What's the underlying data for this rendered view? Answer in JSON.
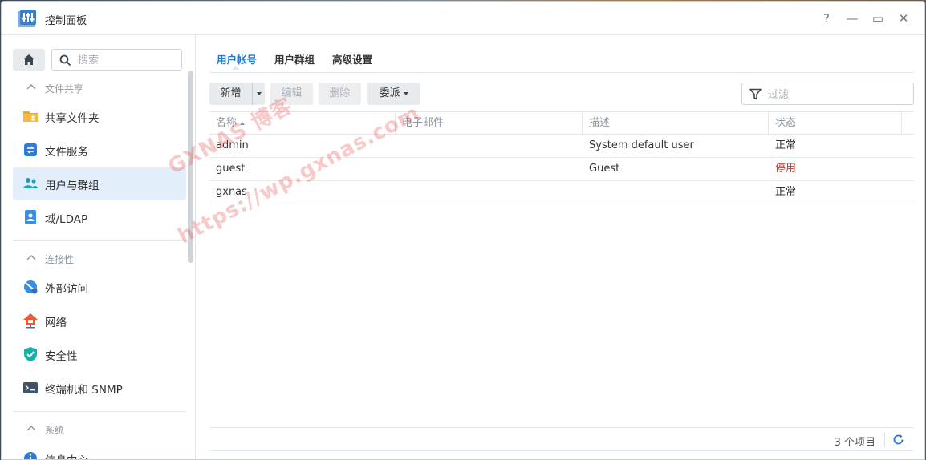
{
  "window": {
    "title": "控制面板"
  },
  "window_controls": {
    "help": "?",
    "minimize": "—",
    "maximize": "▭",
    "close": "✕"
  },
  "sidebar": {
    "search_placeholder": "搜索",
    "sections": [
      {
        "label": "文件共享",
        "items": [
          {
            "label": "共享文件夹",
            "icon": "shared-folder-icon"
          },
          {
            "label": "文件服务",
            "icon": "file-services-icon"
          },
          {
            "label": "用户与群组",
            "icon": "users-groups-icon",
            "active": true
          },
          {
            "label": "域/LDAP",
            "icon": "domain-ldap-icon"
          }
        ]
      },
      {
        "label": "连接性",
        "items": [
          {
            "label": "外部访问",
            "icon": "external-access-icon"
          },
          {
            "label": "网络",
            "icon": "network-icon"
          },
          {
            "label": "安全性",
            "icon": "security-shield-icon"
          },
          {
            "label": "终端机和 SNMP",
            "icon": "terminal-icon"
          }
        ]
      },
      {
        "label": "系统",
        "items": [
          {
            "label": "信息中心",
            "icon": "info-center-icon"
          }
        ]
      }
    ]
  },
  "tabs": [
    {
      "label": "用户帐号",
      "active": true
    },
    {
      "label": "用户群组"
    },
    {
      "label": "高级设置"
    }
  ],
  "toolbar": {
    "create": "新增",
    "edit": "编辑",
    "delete": "删除",
    "delegate": "委派",
    "filter_placeholder": "过滤"
  },
  "table": {
    "columns": [
      "名称",
      "电子邮件",
      "描述",
      "状态"
    ],
    "rows": [
      {
        "name": "admin",
        "email": "",
        "description": "System default user",
        "status": "正常"
      },
      {
        "name": "guest",
        "email": "",
        "description": "Guest",
        "status": "停用"
      },
      {
        "name": "gxnas",
        "email": "",
        "description": "",
        "status": "正常"
      }
    ]
  },
  "footer": {
    "count": "3 个项目"
  },
  "watermark": {
    "line1": "GXNAS 博客",
    "line2": "https://wp.gxnas.com"
  },
  "colors": {
    "accent": "#1d7ad0",
    "active_bg": "#e2eefa",
    "disabled_status": "#d33a2c"
  }
}
